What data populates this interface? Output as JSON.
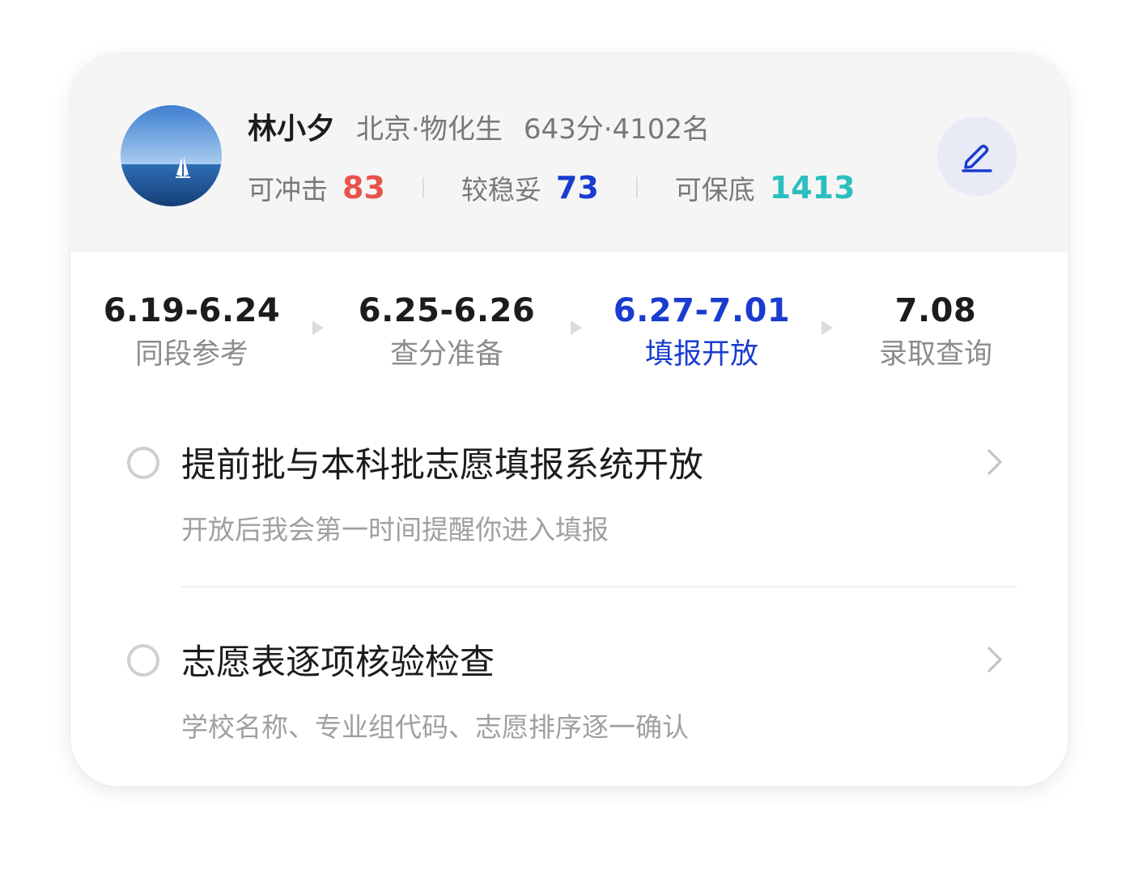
{
  "profile": {
    "name": "林小夕",
    "region": "北京·物化生",
    "score": "643分·4102名",
    "stats": [
      {
        "label": "可冲击",
        "value": "83",
        "color": "#e8534a"
      },
      {
        "label": "较稳妥",
        "value": "73",
        "color": "#1a3ccf"
      },
      {
        "label": "可保底",
        "value": "1413",
        "color": "#2cbfbf"
      }
    ],
    "edit_icon": "pencil-icon"
  },
  "timeline": [
    {
      "date": "6.19-6.24",
      "label": "同段参考",
      "active": false
    },
    {
      "date": "6.25-6.26",
      "label": "查分准备",
      "active": false
    },
    {
      "date": "6.27-7.01",
      "label": "填报开放",
      "active": true
    },
    {
      "date": "7.08",
      "label": "录取查询",
      "active": false
    }
  ],
  "tasks": [
    {
      "title": "提前批与本科批志愿填报系统开放",
      "subtitle": "开放后我会第一时间提醒你进入填报"
    },
    {
      "title": "志愿表逐项核验检查",
      "subtitle": "学校名称、专业组代码、志愿排序逐一确认"
    }
  ],
  "colors": {
    "accent": "#1a3ccf",
    "red": "#e8534a",
    "teal": "#2cbfbf",
    "header_bg": "#f5f5f6",
    "edit_bg": "#e8eaf6"
  }
}
